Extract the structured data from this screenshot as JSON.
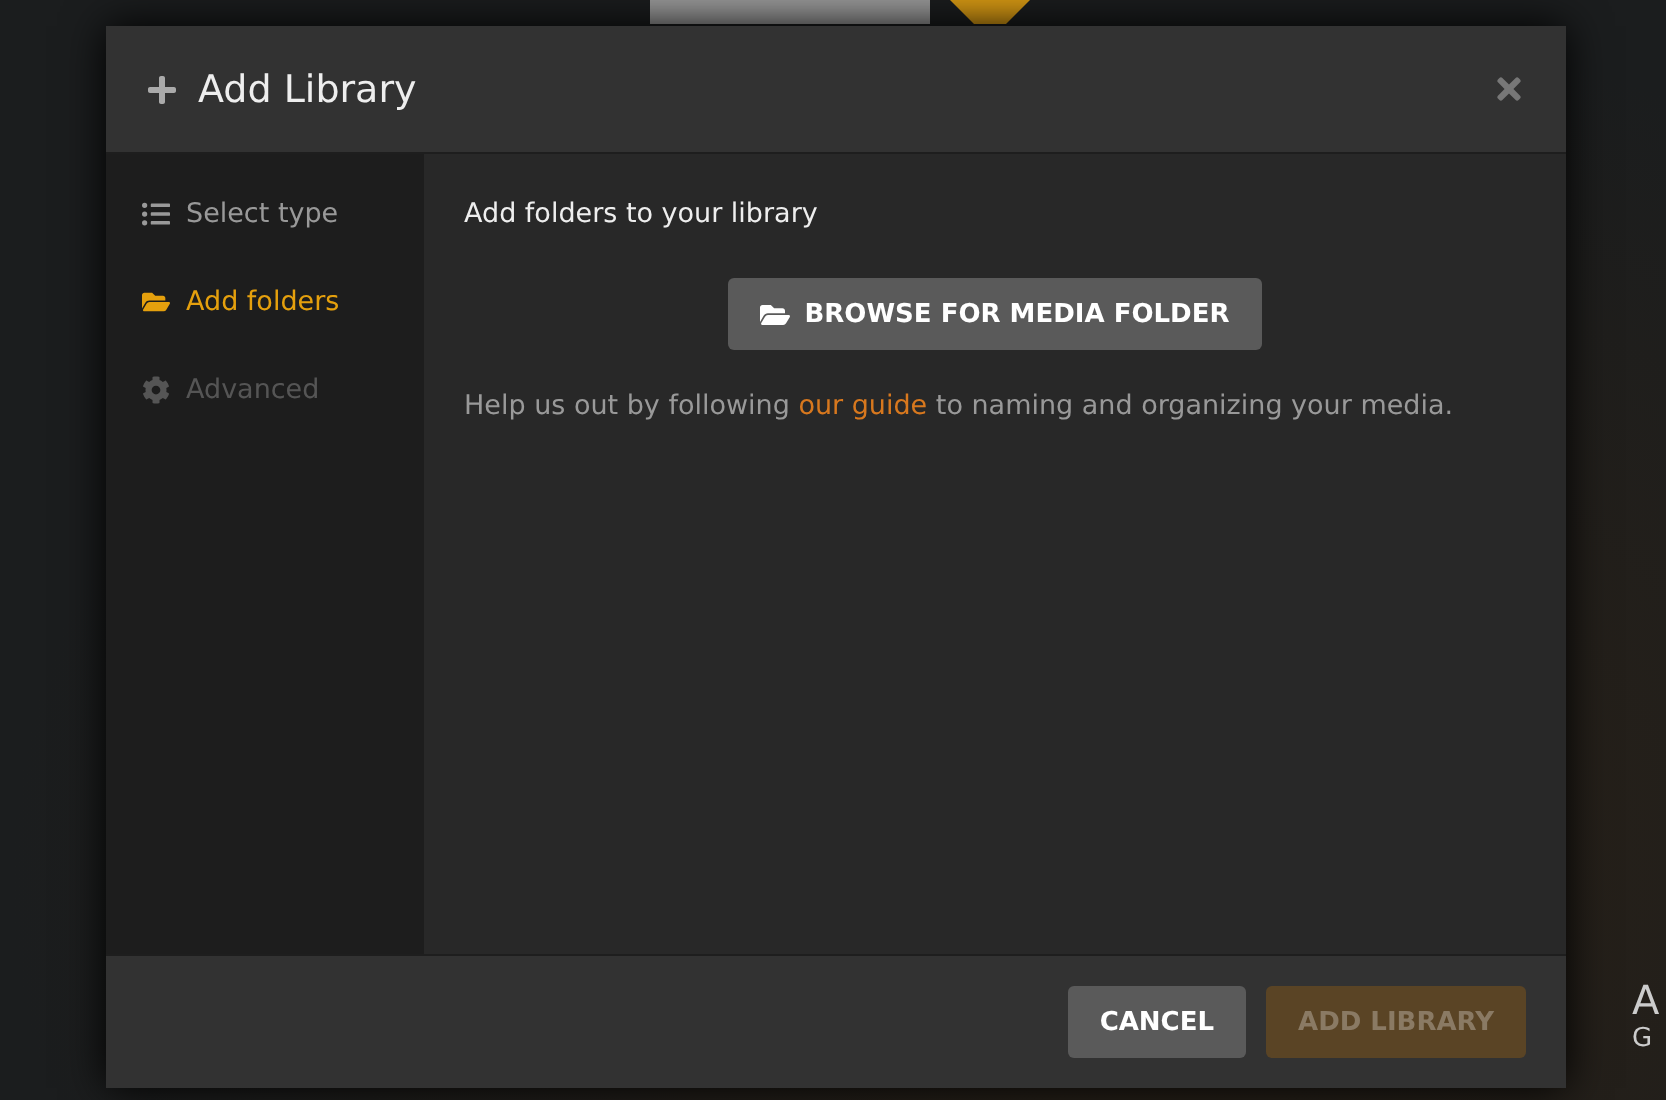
{
  "background": {
    "texts": [
      "A",
      "G"
    ]
  },
  "dialog": {
    "title": "Add Library"
  },
  "steps": [
    {
      "label": "Select type",
      "kind": "list",
      "selected": false,
      "disabled": false
    },
    {
      "label": "Add folders",
      "kind": "folder",
      "selected": true,
      "disabled": false
    },
    {
      "label": "Advanced",
      "kind": "gear",
      "selected": false,
      "disabled": true
    }
  ],
  "content": {
    "heading": "Add folders to your library",
    "browse_button": "BROWSE FOR MEDIA FOLDER",
    "help_before": "Help us out by following ",
    "help_link": "our guide",
    "help_after": " to naming and organizing your media."
  },
  "buttons": [
    {
      "label": "CANCEL",
      "kind": "secondary",
      "disabled": false
    },
    {
      "label": "ADD LIBRARY",
      "kind": "primary",
      "disabled": true
    }
  ]
}
